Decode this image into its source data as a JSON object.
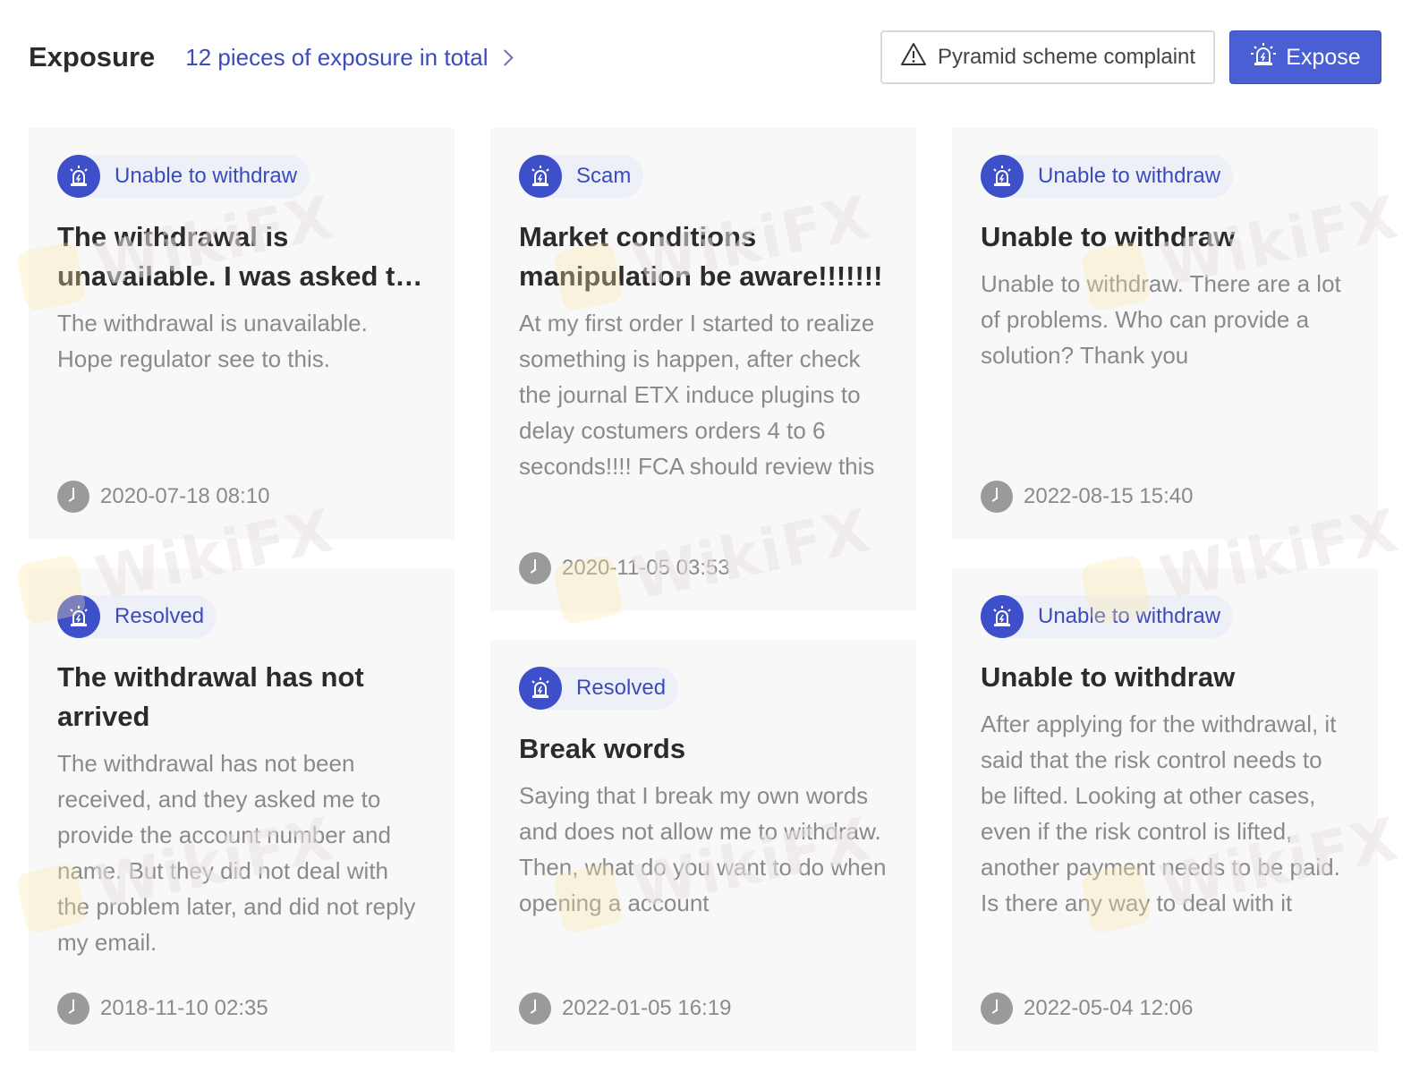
{
  "header": {
    "title": "Exposure",
    "total_link": "12 pieces of exposure in total",
    "complaint_button": "Pyramid scheme complaint",
    "expose_button": "Expose"
  },
  "watermark": "WikiFX",
  "colors": {
    "accent": "#3d4fc9",
    "tag_background": "#eef0f8",
    "card_background": "#f8f8f8"
  },
  "cards": [
    {
      "tag": "Unable to withdraw",
      "title": "The withdrawal is unavailable. I was asked to provide",
      "body": "The withdrawal is unavailable. Hope regulator see to this.",
      "time": "2020-07-18 08:10"
    },
    {
      "tag": "Scam",
      "title": "Market conditions manipulation be aware!!!!!!!",
      "body": "At my first order I started to realize something is happen, after check the journal ETX induce plugins to delay costumers orders 4 to 6 seconds!!!! FCA should review this",
      "time": "2020-11-05 03:53"
    },
    {
      "tag": "Unable to withdraw",
      "title": "Unable to withdraw",
      "body": "Unable to withdraw. There are a lot of problems. Who can provide a solution? Thank you",
      "time": "2022-08-15 15:40"
    },
    {
      "tag": "Resolved",
      "title": "The withdrawal has not arrived",
      "body": "The withdrawal has not been received, and they asked me to provide the account number and name. But they did not deal with the problem later, and did not reply my email.",
      "time": "2018-11-10 02:35"
    },
    {
      "tag": "Resolved",
      "title": "Break words",
      "body": "Saying that I break my own words and does not allow me to withdraw. Then, what do you want to do when opening a account",
      "time": "2022-01-05 16:19"
    },
    {
      "tag": "Unable to withdraw",
      "title": "Unable to withdraw",
      "body": "After applying for the withdrawal, it said that the risk control needs to be lifted. Looking at other cases, even if the risk control is lifted, another payment needs to be paid. Is there any way to deal with it",
      "time": "2022-05-04 12:06"
    }
  ]
}
